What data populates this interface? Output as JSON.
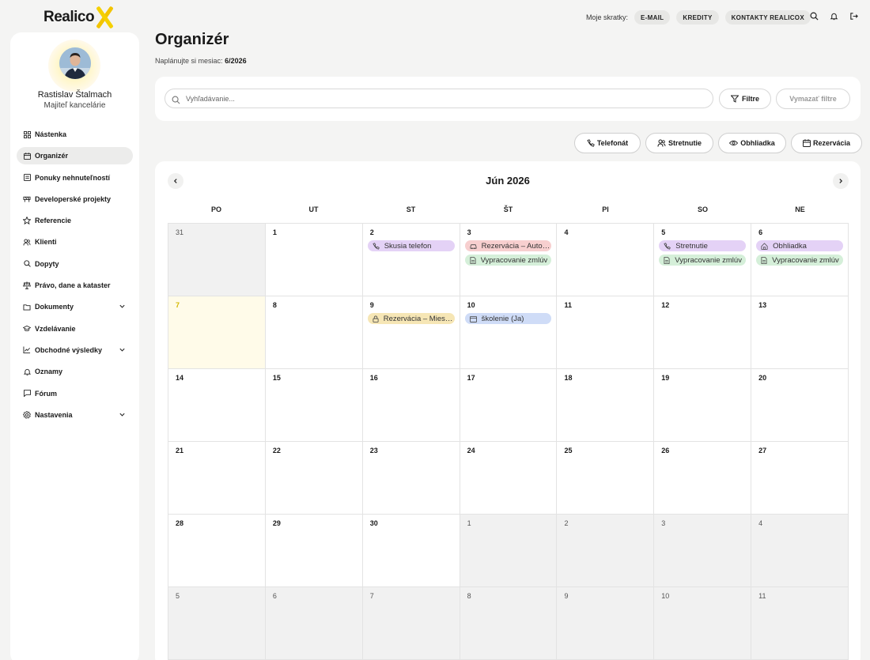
{
  "brand": {
    "logo_text": "Realico"
  },
  "topbar": {
    "shortcuts_label": "Moje skratky:",
    "shortcuts": [
      "E-MAIL",
      "KREDITY",
      "KONTAKTY REALICOX"
    ]
  },
  "user": {
    "name": "Rastislav Štalmach",
    "role": "Majiteľ kancelárie"
  },
  "sidebar": {
    "items": [
      {
        "label": "Nástenka",
        "icon": "grid-icon",
        "active": false,
        "expandable": false
      },
      {
        "label": "Organizér",
        "icon": "calendar-icon",
        "active": true,
        "expandable": false
      },
      {
        "label": "Ponuky nehnuteľností",
        "icon": "document-icon",
        "active": false,
        "expandable": false
      },
      {
        "label": "Developerské projekty",
        "icon": "barrier-icon",
        "active": false,
        "expandable": false
      },
      {
        "label": "Referencie",
        "icon": "star-icon",
        "active": false,
        "expandable": false
      },
      {
        "label": "Klienti",
        "icon": "users-icon",
        "active": false,
        "expandable": false
      },
      {
        "label": "Dopyty",
        "icon": "search-icon",
        "active": false,
        "expandable": false
      },
      {
        "label": "Právo, dane a kataster",
        "icon": "scales-icon",
        "active": false,
        "expandable": false
      },
      {
        "label": "Dokumenty",
        "icon": "folder-icon",
        "active": false,
        "expandable": true
      },
      {
        "label": "Vzdelávanie",
        "icon": "graduation-cap-icon",
        "active": false,
        "expandable": false
      },
      {
        "label": "Obchodné výsledky",
        "icon": "chart-icon",
        "active": false,
        "expandable": true
      },
      {
        "label": "Oznamy",
        "icon": "bell-icon",
        "active": false,
        "expandable": false
      },
      {
        "label": "Fórum",
        "icon": "chat-icon",
        "active": false,
        "expandable": false
      },
      {
        "label": "Nastavenia",
        "icon": "gear-icon",
        "active": false,
        "expandable": true
      }
    ]
  },
  "page": {
    "title": "Organizér",
    "subtitle_prefix": "Naplánujte si mesiac:",
    "subtitle_value": "6/2026"
  },
  "search": {
    "placeholder": "Vyhľadávanie...",
    "value": "",
    "filter_label": "Filtre",
    "clear_label": "Vymazať filtre"
  },
  "event_types": [
    {
      "label": "Telefonát",
      "icon": "phone-icon"
    },
    {
      "label": "Stretnutie",
      "icon": "users-icon"
    },
    {
      "label": "Obhliadka",
      "icon": "eye-icon"
    },
    {
      "label": "Rezervácia",
      "icon": "calendar-icon"
    }
  ],
  "calendar": {
    "month_title": "Jún 2026",
    "weekdays": [
      "PO",
      "UT",
      "ST",
      "ŠT",
      "PI",
      "SO",
      "NE"
    ],
    "weeks": [
      [
        {
          "day": "31",
          "outside": true,
          "today": false,
          "events": []
        },
        {
          "day": "1",
          "outside": false,
          "today": false,
          "events": []
        },
        {
          "day": "2",
          "outside": false,
          "today": false,
          "events": [
            {
              "label": "Skusia telefon",
              "color": "purple",
              "icon": "phone-icon"
            }
          ]
        },
        {
          "day": "3",
          "outside": false,
          "today": false,
          "events": [
            {
              "label": "Rezervácia – Auto (Rastislav)",
              "color": "red",
              "icon": "car-icon"
            },
            {
              "label": "Vypracovanie zmlúv",
              "color": "green",
              "icon": "document-icon"
            }
          ]
        },
        {
          "day": "4",
          "outside": false,
          "today": false,
          "events": []
        },
        {
          "day": "5",
          "outside": false,
          "today": false,
          "events": [
            {
              "label": "Stretnutie",
              "color": "purple",
              "icon": "phone-icon"
            },
            {
              "label": "Vypracovanie zmlúv",
              "color": "green",
              "icon": "document-icon"
            }
          ]
        },
        {
          "day": "6",
          "outside": false,
          "today": false,
          "events": [
            {
              "label": "Obhliadka",
              "color": "purple",
              "icon": "home-icon"
            },
            {
              "label": "Vypracovanie zmlúv",
              "color": "green",
              "icon": "document-icon"
            }
          ]
        }
      ],
      [
        {
          "day": "7",
          "outside": false,
          "today": true,
          "events": []
        },
        {
          "day": "8",
          "outside": false,
          "today": false,
          "events": []
        },
        {
          "day": "9",
          "outside": false,
          "today": false,
          "events": [
            {
              "label": "Rezervácia – Miestnosť",
              "color": "yellow",
              "icon": "lock-icon"
            }
          ]
        },
        {
          "day": "10",
          "outside": false,
          "today": false,
          "events": [
            {
              "label": "školenie (Ja)",
              "color": "blue",
              "icon": "calendar-icon"
            }
          ]
        },
        {
          "day": "11",
          "outside": false,
          "today": false,
          "events": []
        },
        {
          "day": "12",
          "outside": false,
          "today": false,
          "events": []
        },
        {
          "day": "13",
          "outside": false,
          "today": false,
          "events": []
        }
      ],
      [
        {
          "day": "14",
          "outside": false,
          "today": false,
          "events": []
        },
        {
          "day": "15",
          "outside": false,
          "today": false,
          "events": []
        },
        {
          "day": "16",
          "outside": false,
          "today": false,
          "events": []
        },
        {
          "day": "17",
          "outside": false,
          "today": false,
          "events": []
        },
        {
          "day": "18",
          "outside": false,
          "today": false,
          "events": []
        },
        {
          "day": "19",
          "outside": false,
          "today": false,
          "events": []
        },
        {
          "day": "20",
          "outside": false,
          "today": false,
          "events": []
        }
      ],
      [
        {
          "day": "21",
          "outside": false,
          "today": false,
          "events": []
        },
        {
          "day": "22",
          "outside": false,
          "today": false,
          "events": []
        },
        {
          "day": "23",
          "outside": false,
          "today": false,
          "events": []
        },
        {
          "day": "24",
          "outside": false,
          "today": false,
          "events": []
        },
        {
          "day": "25",
          "outside": false,
          "today": false,
          "events": []
        },
        {
          "day": "26",
          "outside": false,
          "today": false,
          "events": []
        },
        {
          "day": "27",
          "outside": false,
          "today": false,
          "events": []
        }
      ],
      [
        {
          "day": "28",
          "outside": false,
          "today": false,
          "events": []
        },
        {
          "day": "29",
          "outside": false,
          "today": false,
          "events": []
        },
        {
          "day": "30",
          "outside": false,
          "today": false,
          "events": []
        },
        {
          "day": "1",
          "outside": true,
          "today": false,
          "events": []
        },
        {
          "day": "2",
          "outside": true,
          "today": false,
          "events": []
        },
        {
          "day": "3",
          "outside": true,
          "today": false,
          "events": []
        },
        {
          "day": "4",
          "outside": true,
          "today": false,
          "events": []
        }
      ],
      [
        {
          "day": "5",
          "outside": true,
          "today": false,
          "events": []
        },
        {
          "day": "6",
          "outside": true,
          "today": false,
          "events": []
        },
        {
          "day": "7",
          "outside": true,
          "today": false,
          "events": []
        },
        {
          "day": "8",
          "outside": true,
          "today": false,
          "events": []
        },
        {
          "day": "9",
          "outside": true,
          "today": false,
          "events": []
        },
        {
          "day": "10",
          "outside": true,
          "today": false,
          "events": []
        },
        {
          "day": "11",
          "outside": true,
          "today": false,
          "events": []
        }
      ]
    ]
  },
  "colors": {
    "accent": "#f3c400",
    "event_purple": "#e4d2f6",
    "event_green": "#d5efd9",
    "event_red": "#f7cfcf",
    "event_yellow": "#f6e6b5",
    "event_blue": "#cfdcf7"
  }
}
